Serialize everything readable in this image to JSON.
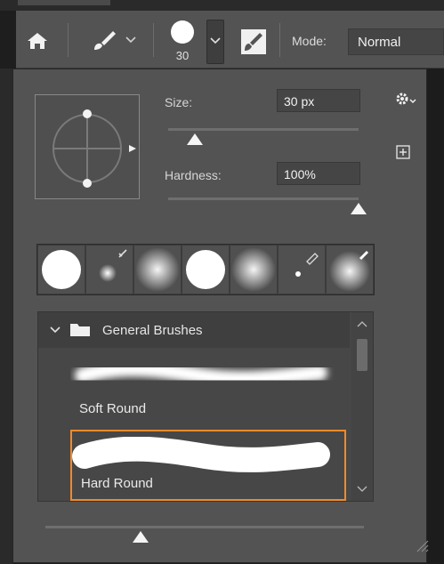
{
  "optionsBar": {
    "brushSizeValue": "30",
    "modeLabel": "Mode:",
    "modeValue": "Normal",
    "icons": [
      "home-icon",
      "brush-icon",
      "chevron-down-icon",
      "brush-settings-icon"
    ]
  },
  "panel": {
    "sizeLabel": "Size:",
    "sizeValue": "30 px",
    "sizeSliderFraction": 0.14,
    "hardnessLabel": "Hardness:",
    "hardnessValue": "100%",
    "hardnessSliderFraction": 1.0,
    "icons": [
      "gear-menu-icon",
      "new-preset-icon"
    ]
  },
  "recentBrushes": [
    {
      "kind": "hard",
      "size": "large"
    },
    {
      "kind": "soft-small",
      "tool": "pencil"
    },
    {
      "kind": "soft",
      "size": "large"
    },
    {
      "kind": "hard",
      "size": "large"
    },
    {
      "kind": "soft",
      "size": "large"
    },
    {
      "kind": "hard-tiny",
      "tool": "pencil"
    },
    {
      "kind": "soft",
      "size": "large",
      "tool": "pencil"
    }
  ],
  "brushList": {
    "groupName": "General Brushes",
    "items": [
      {
        "name": "Soft Round",
        "selected": false
      },
      {
        "name": "Hard Round",
        "selected": true
      }
    ]
  },
  "bottomSliderFraction": 0.3,
  "colors": {
    "accent": "#f08a2a",
    "panel": "#535353",
    "background": "#1e1e1e"
  }
}
